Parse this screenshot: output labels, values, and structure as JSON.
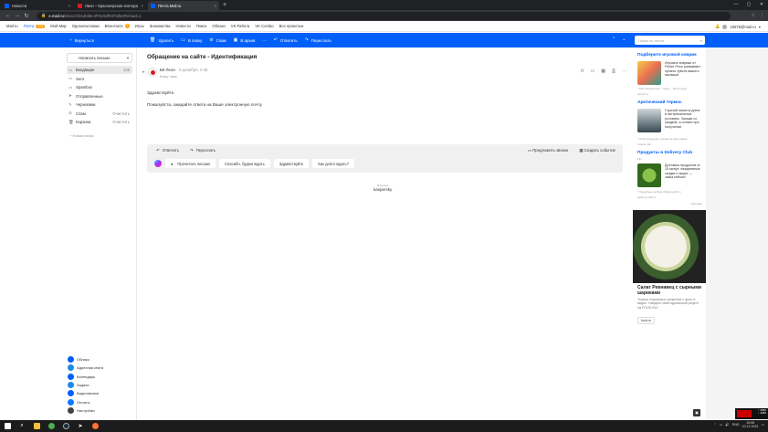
{
  "browser": {
    "tabs": [
      {
        "label": "Новости",
        "color": "#005ff9",
        "active": false
      },
      {
        "label": "Лион – Красноярская контора",
        "color": "#d31d24",
        "active": false
      },
      {
        "label": "Почта Mail.ru",
        "color": "#005ff9",
        "active": true
      }
    ],
    "new_tab": "+",
    "url_host": "e.mail.ru",
    "url_path": "/inbox/1f31d0d6c4f76c52f03/?afterReload=1"
  },
  "portal": {
    "items": [
      {
        "label": "Mail.ru",
        "blue": false
      },
      {
        "label": "Почта",
        "blue": true,
        "badge": "226"
      },
      {
        "label": "Мой Мир",
        "blue": false
      },
      {
        "label": "Одноклассники",
        "blue": false
      },
      {
        "label": "ВКонтакте",
        "blue": false,
        "badge": "3"
      },
      {
        "label": "Игры",
        "blue": false
      },
      {
        "label": "Знакомства",
        "blue": false
      },
      {
        "label": "Новости",
        "blue": false
      },
      {
        "label": "Поиск",
        "blue": false
      },
      {
        "label": "Облако",
        "blue": false
      },
      {
        "label": "VK Работа",
        "blue": false
      },
      {
        "label": "VK Combo",
        "blue": false
      },
      {
        "label": "Все проекты",
        "blue": false
      }
    ],
    "user_email": "16576@mail.ru"
  },
  "toolbar": {
    "back": "Вернуться",
    "delete": "Удалить",
    "to_folder": "В папку",
    "spam": "Спам",
    "archive": "В архив",
    "more": "···",
    "reply": "Ответить",
    "forward": "Переслать",
    "search_placeholder": "Поиск по почте"
  },
  "sidebar": {
    "compose": "Написать письмо",
    "folders": [
      {
        "label": "Входящие",
        "count": "226",
        "icon": "inbox-icon",
        "glyph": "▭",
        "selected": true
      },
      {
        "label": "Sent",
        "count": "",
        "icon": "folder-icon",
        "glyph": "▭",
        "selected": false
      },
      {
        "label": "Spambox",
        "count": "",
        "icon": "folder-icon",
        "glyph": "▭",
        "selected": false
      },
      {
        "label": "Отправленные",
        "count": "",
        "icon": "sent-icon",
        "glyph": "➤",
        "selected": false
      },
      {
        "label": "Черновики",
        "count": "",
        "icon": "draft-icon",
        "glyph": "✎",
        "selected": false
      },
      {
        "label": "Спам",
        "count": "Очистить",
        "icon": "spam-icon",
        "glyph": "⊘",
        "selected": false
      },
      {
        "label": "Корзина",
        "count": "Очистить",
        "icon": "trash-icon",
        "glyph": "🗑",
        "selected": false
      }
    ],
    "new_folder": "Новая папка",
    "services": [
      {
        "label": "Облако",
        "color": "#005ff9"
      },
      {
        "label": "Адресная книга",
        "color": "#168de2"
      },
      {
        "label": "Календарь",
        "color": "#005ff9"
      },
      {
        "label": "Задачи",
        "color": "#1e88e5"
      },
      {
        "label": "Видеозвонки",
        "color": "#005ff9"
      },
      {
        "label": "Оплаты",
        "color": "#0a7bff"
      },
      {
        "label": "Настройки",
        "color": "#444444"
      }
    ]
  },
  "message": {
    "subject": "Обращение на сайте - Идентификация",
    "sender": "БК Леон",
    "date": "6 декабря, 0:38",
    "recipient": "Кому: вам",
    "greeting": "Здравствуйте.",
    "text": "Пожалуйста, ожидайте ответа на Ваше электронную почту."
  },
  "reply_box": {
    "reply": "Ответить",
    "forward": "Переслать",
    "offer_call": "Предложить звонок",
    "create_event": "Создать событие",
    "chips": [
      "Прочитать письмо",
      "Спасибо, будем ждать",
      "Здравствуйте",
      "Как долго ждать?"
    ]
  },
  "kaspersky": {
    "small": "Проверено",
    "name": "kaspersky"
  },
  "ads": {
    "ad1_title": "Подберите игровой коврик",
    "ad1_text": "Игровые коврики от Fisher-Price развивают органы чувств вашего малыша!",
    "ad1_meta": "* 63% 'Игровой мат', 'товар..., Мате-рудия",
    "ad1_src": "detmir.ru",
    "ad2_title": "Арктический термос",
    "ad2_text": "Горячий напиток днем в экстремальных условиях. Закажи со скидкой, а оплати при получении",
    "ad2_meta": "* Успех продукции. Скидка на день заказа",
    "ad2_src": "термос.рф",
    "ad3_title": "Продукты в Delivery Club",
    "ad3_sub": "18+",
    "ad3_text": "Доставка продуктов от 15 минут: ежедневные скидки и акции — заказ сейчас!",
    "ad3_meta": "* Подробнее на https://deliveryclub.ru",
    "ad3_src": "delivery-club.ru",
    "ad_label": "Реклама",
    "salad_title": "Салат Ревнивец с сырными шариками",
    "salad_text": "Тысячи пошаговых рецептов с фото и видео. Найдите свой идеальный рецепт на FOOD.RU!",
    "salad_btn": "food.ru"
  },
  "overlay": {
    "line1": "↑ 2050",
    "line2": "↓ 2050"
  },
  "taskbar": {
    "lang": "ENG",
    "time": "10:06",
    "date": "10.12.2021"
  }
}
